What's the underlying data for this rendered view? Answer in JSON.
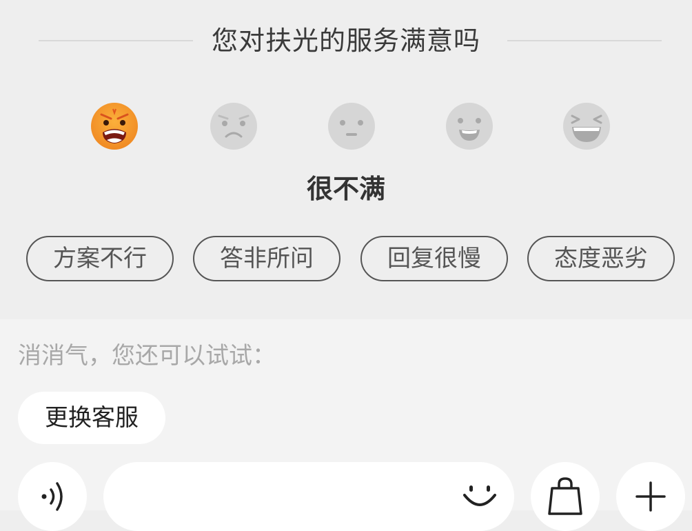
{
  "survey": {
    "title": "您对扶光的服务满意吗",
    "selected_label": "很不满",
    "faces": [
      {
        "icon": "angry-face-icon",
        "selected": true
      },
      {
        "icon": "sad-face-icon",
        "selected": false
      },
      {
        "icon": "neutral-face-icon",
        "selected": false
      },
      {
        "icon": "smile-face-icon",
        "selected": false
      },
      {
        "icon": "laugh-face-icon",
        "selected": false
      }
    ],
    "tags": [
      "方案不行",
      "答非所问",
      "回复很慢",
      "态度恶劣"
    ]
  },
  "suggestion": {
    "hint": "消消气，您还可以试试：",
    "chip": "更换客服"
  },
  "input_bar": {
    "voice_icon": "voice-icon",
    "emoji_icon": "emoji-icon",
    "shop_icon": "shopping-bag-icon",
    "add_icon": "plus-icon"
  },
  "colors": {
    "survey_bg": "#eeeeee",
    "bottom_bg": "#f3f3f3",
    "selected_face": "#f5a623",
    "inactive_face": "#d6d6d6"
  }
}
